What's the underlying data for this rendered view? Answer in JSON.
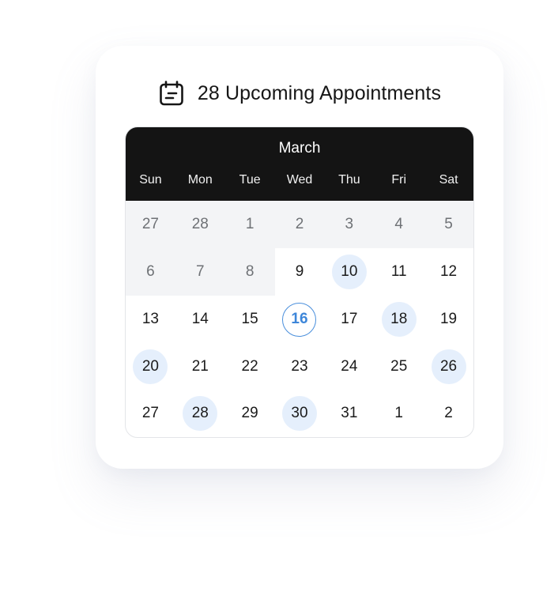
{
  "header": {
    "icon": "calendar-icon",
    "title": "28 Upcoming Appointments"
  },
  "calendar": {
    "month": "March",
    "weekdays": [
      "Sun",
      "Mon",
      "Tue",
      "Wed",
      "Thu",
      "Fri",
      "Sat"
    ],
    "weeks": [
      [
        {
          "day": "27",
          "state": "past"
        },
        {
          "day": "28",
          "state": "past"
        },
        {
          "day": "1",
          "state": "past"
        },
        {
          "day": "2",
          "state": "past"
        },
        {
          "day": "3",
          "state": "past"
        },
        {
          "day": "4",
          "state": "past"
        },
        {
          "day": "5",
          "state": "past"
        }
      ],
      [
        {
          "day": "6",
          "state": "past"
        },
        {
          "day": "7",
          "state": "past"
        },
        {
          "day": "8",
          "state": "past"
        },
        {
          "day": "9",
          "state": "normal"
        },
        {
          "day": "10",
          "state": "appointment"
        },
        {
          "day": "11",
          "state": "normal"
        },
        {
          "day": "12",
          "state": "normal"
        }
      ],
      [
        {
          "day": "13",
          "state": "normal"
        },
        {
          "day": "14",
          "state": "normal"
        },
        {
          "day": "15",
          "state": "normal"
        },
        {
          "day": "16",
          "state": "today"
        },
        {
          "day": "17",
          "state": "normal"
        },
        {
          "day": "18",
          "state": "appointment"
        },
        {
          "day": "19",
          "state": "normal"
        }
      ],
      [
        {
          "day": "20",
          "state": "appointment"
        },
        {
          "day": "21",
          "state": "normal"
        },
        {
          "day": "22",
          "state": "normal"
        },
        {
          "day": "23",
          "state": "normal"
        },
        {
          "day": "24",
          "state": "normal"
        },
        {
          "day": "25",
          "state": "normal"
        },
        {
          "day": "26",
          "state": "appointment"
        }
      ],
      [
        {
          "day": "27",
          "state": "normal"
        },
        {
          "day": "28",
          "state": "appointment"
        },
        {
          "day": "29",
          "state": "normal"
        },
        {
          "day": "30",
          "state": "appointment"
        },
        {
          "day": "31",
          "state": "normal"
        },
        {
          "day": "1",
          "state": "normal"
        },
        {
          "day": "2",
          "state": "normal"
        }
      ]
    ]
  },
  "colors": {
    "header_bg": "#141414",
    "past_bg": "#f3f4f6",
    "appointment_bg": "#e5effc",
    "today_accent": "#4a8fdc"
  }
}
